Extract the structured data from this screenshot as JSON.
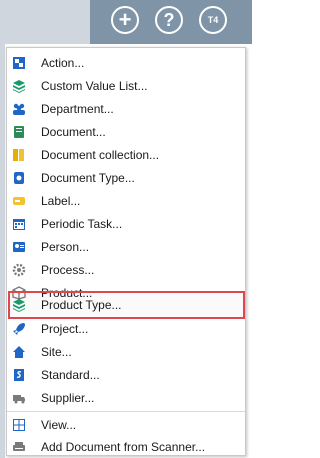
{
  "header": {
    "add_glyph": "+",
    "help_glyph": "?",
    "user_initials": "T4"
  },
  "menu": {
    "items": [
      {
        "label": "Action...",
        "icon": "action-icon",
        "color": "#1f66c6"
      },
      {
        "label": "Custom Value List...",
        "icon": "stack-icon",
        "color": "#1a9a6a"
      },
      {
        "label": "Department...",
        "icon": "people-icon",
        "color": "#1f66c6"
      },
      {
        "label": "Document...",
        "icon": "document-icon",
        "color": "#2e8b57"
      },
      {
        "label": "Document collection...",
        "icon": "folder-icon",
        "color": "#e6b000"
      },
      {
        "label": "Document Type...",
        "icon": "document-type-icon",
        "color": "#1f66c6"
      },
      {
        "label": "Label...",
        "icon": "tag-icon",
        "color": "#f1c232"
      },
      {
        "label": "Periodic Task...",
        "icon": "calendar-icon",
        "color": "#1f66c6"
      },
      {
        "label": "Person...",
        "icon": "person-card-icon",
        "color": "#1f66c6"
      },
      {
        "label": "Process...",
        "icon": "gear-icon",
        "color": "#7a7a7a"
      },
      {
        "label": "Product...",
        "icon": "box-icon",
        "color": "#7a7a7a"
      },
      {
        "label": "Product Type...",
        "icon": "stack-icon",
        "color": "#1a9a6a",
        "highlighted": true
      },
      {
        "label": "Project...",
        "icon": "rocket-icon",
        "color": "#1f66c6"
      },
      {
        "label": "Site...",
        "icon": "home-icon",
        "color": "#1f66c6"
      },
      {
        "label": "Standard...",
        "icon": "standard-icon",
        "color": "#1f66c6"
      },
      {
        "label": "Supplier...",
        "icon": "truck-icon",
        "color": "#7a7a7a"
      }
    ],
    "bottom_items": [
      {
        "label": "View...",
        "icon": "view-grid-icon",
        "color": "#1f66c6"
      },
      {
        "label": "Add Document from Scanner...",
        "icon": "scanner-icon",
        "color": "#7a7a7a"
      }
    ]
  }
}
